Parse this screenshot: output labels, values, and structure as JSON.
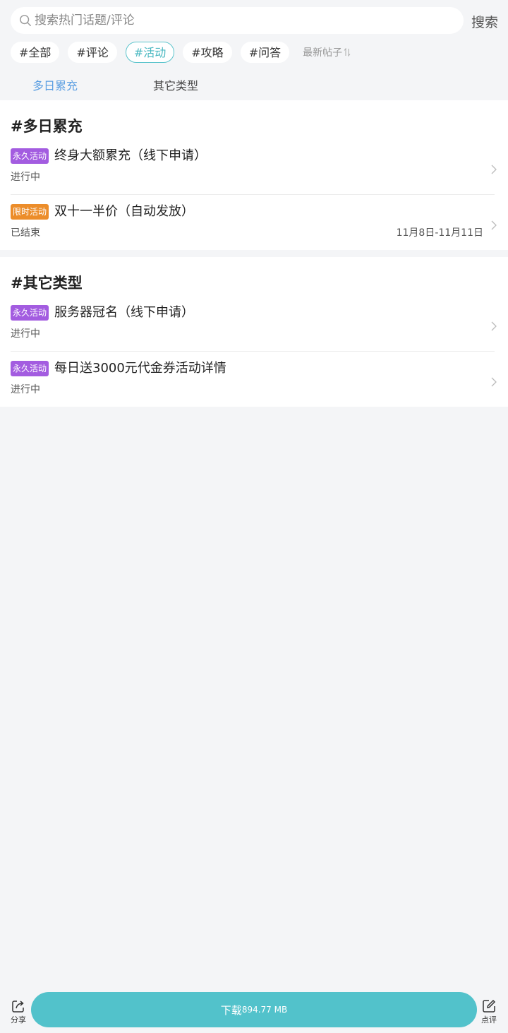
{
  "search": {
    "placeholder": "搜索热门话题/评论",
    "button_label": "搜索"
  },
  "tags": [
    {
      "label": "#全部",
      "active": false
    },
    {
      "label": "#评论",
      "active": false
    },
    {
      "label": "#活动",
      "active": true
    },
    {
      "label": "#攻略",
      "active": false
    },
    {
      "label": "#问答",
      "active": false
    }
  ],
  "sort_label": "最新帖子",
  "subtabs": [
    {
      "label": "多日累充",
      "active": true
    },
    {
      "label": "其它类型",
      "active": false
    }
  ],
  "sections": [
    {
      "title": "#多日累充",
      "items": [
        {
          "badge": "永久活动",
          "badge_type": "perm",
          "title": "终身大额累充（线下申请）",
          "status": "进行中",
          "date": ""
        },
        {
          "badge": "限时活动",
          "badge_type": "limit",
          "title": "双十一半价（自动发放）",
          "status": "已结束",
          "date": "11月8日-11月11日"
        }
      ]
    },
    {
      "title": "#其它类型",
      "items": [
        {
          "badge": "永久活动",
          "badge_type": "perm",
          "title": "服务器冠名（线下申请）",
          "status": "进行中",
          "date": ""
        },
        {
          "badge": "永久活动",
          "badge_type": "perm",
          "title": "每日送3000元代金券活动详情",
          "status": "进行中",
          "date": ""
        }
      ]
    }
  ],
  "bottombar": {
    "share_label": "分享",
    "download_label": "下载",
    "download_size": "894.77 MB",
    "review_label": "点评"
  },
  "colors": {
    "accent": "#52c2cb",
    "tab_active": "#5a9ee2",
    "badge_permanent": "#a35ce0",
    "badge_limited": "#ec8d2a"
  }
}
